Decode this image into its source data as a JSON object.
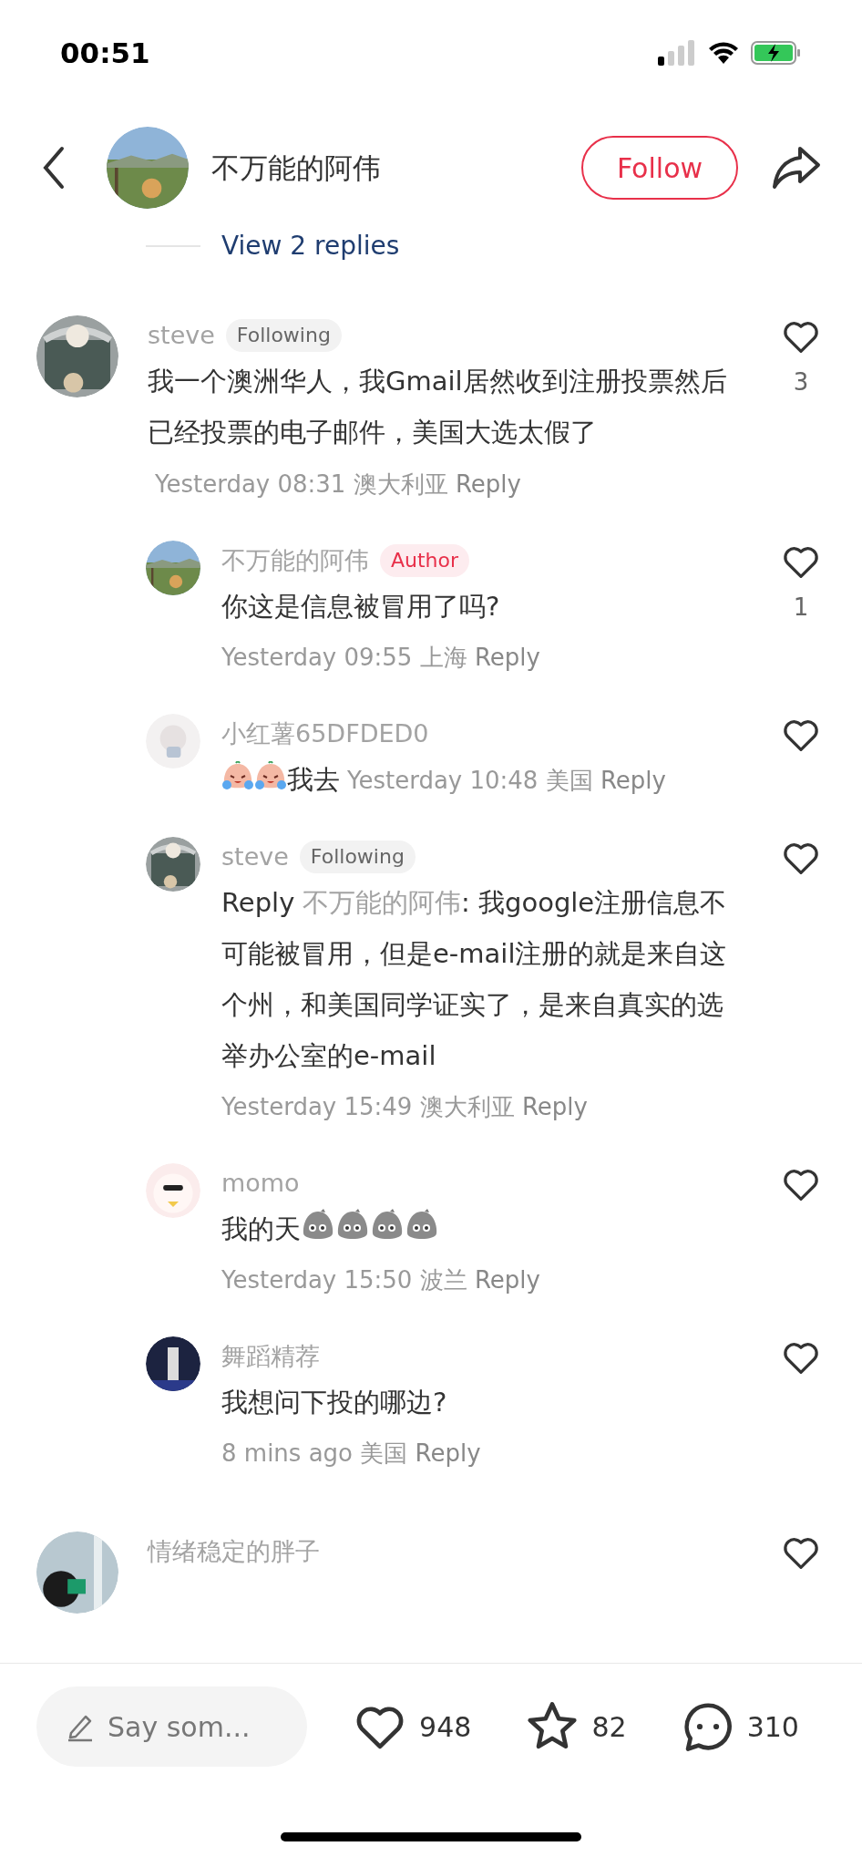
{
  "status_bar": {
    "time": "00:51"
  },
  "header": {
    "author_name": "不万能的阿伟",
    "follow_button": "Follow"
  },
  "view_replies_link": "View 2 replies",
  "comments": [
    {
      "name": "steve",
      "tag": {
        "kind": "following",
        "text": "Following"
      },
      "body": [
        {
          "kind": "text",
          "text": "我一个澳洲华人，我Gmail居然收到注册投票然后已经投票的电子邮件，美国大选太假了"
        }
      ],
      "time": "Yesterday 08:31",
      "location": "澳大利亚",
      "reply": "Reply",
      "meta_inline": true,
      "likes": "3",
      "replies": [
        {
          "name": "不万能的阿伟",
          "tag": {
            "kind": "author",
            "text": "Author"
          },
          "body": [
            {
              "kind": "text",
              "text": "你这是信息被冒用了吗?"
            }
          ],
          "time": "Yesterday 09:55",
          "location": "上海",
          "reply": "Reply",
          "meta_inline": false,
          "likes": "1"
        },
        {
          "name": "小红薯65DFDED0",
          "body": [
            {
              "kind": "crying-sticker"
            },
            {
              "kind": "crying-sticker"
            },
            {
              "kind": "text",
              "text": "我去"
            }
          ],
          "time": "Yesterday 10:48",
          "location": "美国",
          "reply": "Reply",
          "meta_inline": true
        },
        {
          "name": "steve",
          "tag": {
            "kind": "following",
            "text": "Following"
          },
          "body": [
            {
              "kind": "text",
              "text": "Reply"
            },
            {
              "kind": "mention",
              "text": "不万能的阿伟"
            },
            {
              "kind": "text",
              "text": ": 我google注册信息不可能被冒用，但是e-mail注册的就是来自这个州，和美国同学证实了，是来自真实的选举办公室的e-mail"
            }
          ],
          "time": "Yesterday 15:49",
          "location": "澳大利亚",
          "reply": "Reply",
          "meta_inline": false
        },
        {
          "name": "momo",
          "body": [
            {
              "kind": "text",
              "text": "我的天"
            },
            {
              "kind": "stone-sticker"
            },
            {
              "kind": "stone-sticker"
            },
            {
              "kind": "stone-sticker"
            },
            {
              "kind": "stone-sticker"
            }
          ],
          "time": "Yesterday 15:50",
          "location": "波兰",
          "reply": "Reply",
          "meta_inline": false
        },
        {
          "name": "舞蹈精荐",
          "body": [
            {
              "kind": "text",
              "text": "我想问下投的哪边?"
            }
          ],
          "time": "8 mins ago",
          "location": "美国",
          "reply": "Reply",
          "meta_inline": false
        }
      ]
    },
    {
      "name": "情绪稳定的胖子"
    }
  ],
  "bottom_bar": {
    "comment_placeholder": "Say som...",
    "likes": "948",
    "collects": "82",
    "comments": "310"
  }
}
